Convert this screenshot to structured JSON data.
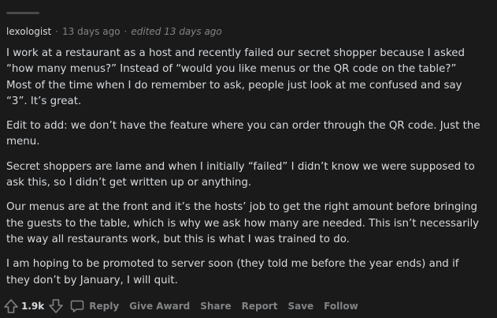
{
  "header": {
    "author": "lexologist",
    "separator": "·",
    "time": "13 days ago",
    "edited": "edited 13 days ago"
  },
  "comment": {
    "paragraphs": [
      "I work at a restaurant as a host and recently failed our secret shopper because I asked “how many menus?” Instead of “would you like menus or the QR code on the table?” Most of the time when I do remember to ask, people just look at me confused and say “3”. It’s great.",
      "Edit to add: we don’t have the feature where you can order through the QR code. Just the menu.",
      "Secret shoppers are lame and when I initially “failed” I didn’t know we were supposed to ask this, so I didn’t get written up or anything.",
      "Our menus are at the front and it’s the hosts’ job to get the right amount before bringing the guests to the table, which is why we ask how many are needed. This isn’t necessarily the way all restaurants work, but this is what I was trained to do.",
      "I am hoping to be promoted to server soon (they told me before the year ends) and if they don’t by January, I will quit."
    ]
  },
  "actions": {
    "score": "1.9k",
    "reply": "Reply",
    "give_award": "Give Award",
    "share": "Share",
    "report": "Report",
    "save": "Save",
    "follow": "Follow"
  },
  "icons": {
    "upvote": "upvote-arrow-icon",
    "downvote": "downvote-arrow-icon",
    "reply": "speech-bubble-icon"
  },
  "colors": {
    "background": "#1a1a1b",
    "text": "#d7dadc",
    "muted": "#818384"
  }
}
